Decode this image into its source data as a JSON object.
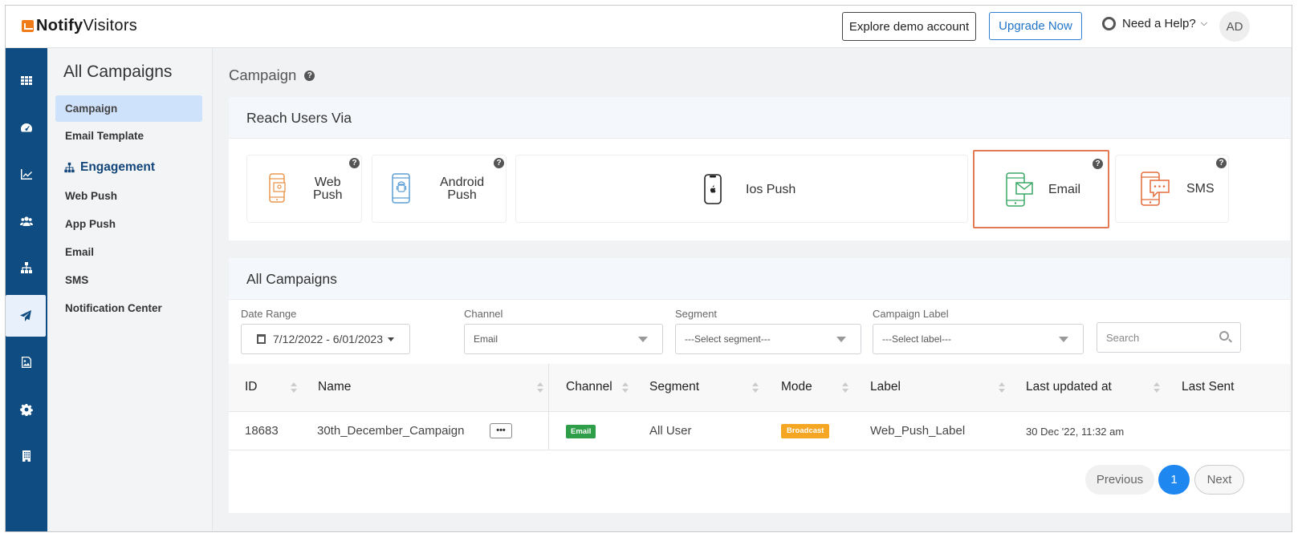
{
  "app": {
    "logo_bold": "Notify",
    "logo_regular": "Visitors"
  },
  "header": {
    "demo_button": "Explore demo account",
    "upgrade_button": "Upgrade Now",
    "help_label": "Need a Help?",
    "avatar_initials": "AD"
  },
  "rail": {
    "icons": [
      "grid-icon",
      "dashboard-icon",
      "analytics-icon",
      "users-icon",
      "hierarchy-icon",
      "send-icon",
      "image-icon",
      "gear-icon",
      "building-icon"
    ],
    "active": "send-icon"
  },
  "sidebar": {
    "title": "All Campaigns",
    "items_top": [
      "Campaign",
      "Email Template"
    ],
    "section": "Engagement",
    "items_engagement": [
      "Web Push",
      "App Push",
      "Email",
      "SMS",
      "Notification Center"
    ]
  },
  "main": {
    "page_title": "Campaign",
    "reach_title": "Reach Users Via",
    "channels": [
      {
        "label_line1": "Web",
        "label_line2": "Push"
      },
      {
        "label_line1": "Android",
        "label_line2": "Push"
      },
      {
        "label_line1": "Ios Push"
      },
      {
        "label_line1": "Email"
      },
      {
        "label_line1": "SMS"
      }
    ],
    "selected_channel": "Email",
    "colors": {
      "accent": "#1e88f0",
      "rail": "#0f4c81",
      "email_badge": "#2e9e48",
      "broadcast_badge": "#f5a623",
      "selected_border": "#e27a55",
      "web_push_icon": "#e9984f",
      "android_icon": "#5b9fd6",
      "email_icon": "#3aa765",
      "sms_icon": "#e36b3a"
    }
  },
  "campaigns": {
    "title": "All Campaigns",
    "filters": {
      "date_label": "Date Range",
      "date_value": "7/12/2022 - 6/01/2023",
      "channel_label": "Channel",
      "channel_value": "Email",
      "segment_label": "Segment",
      "segment_value": "---Select segment---",
      "label_label": "Campaign Label",
      "label_value": "---Select label---",
      "search_placeholder": "Search"
    },
    "columns": [
      "ID",
      "Name",
      "Channel",
      "Segment",
      "Mode",
      "Label",
      "Last updated at",
      "Last Sent"
    ],
    "rows": [
      {
        "id": "18683",
        "name": "30th_December_Campaign",
        "channel": "Email",
        "segment": "All User",
        "mode": "Broadcast",
        "label": "Web_Push_Label",
        "updated": "30 Dec '22, 11:32 am",
        "last_sent": ""
      }
    ],
    "pagination": {
      "previous": "Previous",
      "current_page": "1",
      "next": "Next"
    }
  }
}
